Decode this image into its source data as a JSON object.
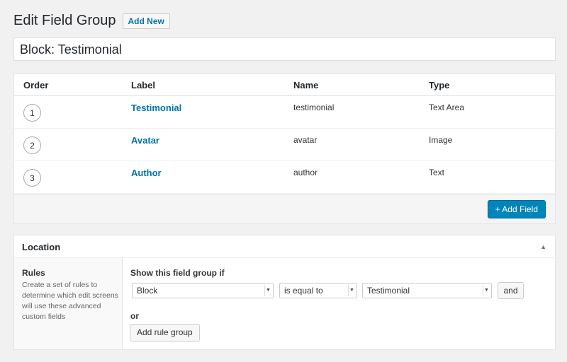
{
  "header": {
    "title": "Edit Field Group",
    "add_new_label": "Add New"
  },
  "title_input": {
    "value": "Block: Testimonial"
  },
  "fields": {
    "columns": {
      "order": "Order",
      "label": "Label",
      "name": "Name",
      "type": "Type"
    },
    "rows": [
      {
        "order": "1",
        "label": "Testimonial",
        "name": "testimonial",
        "type": "Text Area"
      },
      {
        "order": "2",
        "label": "Avatar",
        "name": "avatar",
        "type": "Image"
      },
      {
        "order": "3",
        "label": "Author",
        "name": "author",
        "type": "Text"
      }
    ],
    "add_field_label": "+ Add Field"
  },
  "location": {
    "title": "Location",
    "collapse_icon": "▲",
    "rules_title": "Rules",
    "rules_description": "Create a set of rules to determine which edit screens will use these advanced custom fields",
    "show_if_label": "Show this field group if",
    "param_value": "Block",
    "operator_value": "is equal to",
    "rule_value": "Testimonial",
    "and_label": "and",
    "or_label": "or",
    "add_rule_group_label": "Add rule group"
  }
}
